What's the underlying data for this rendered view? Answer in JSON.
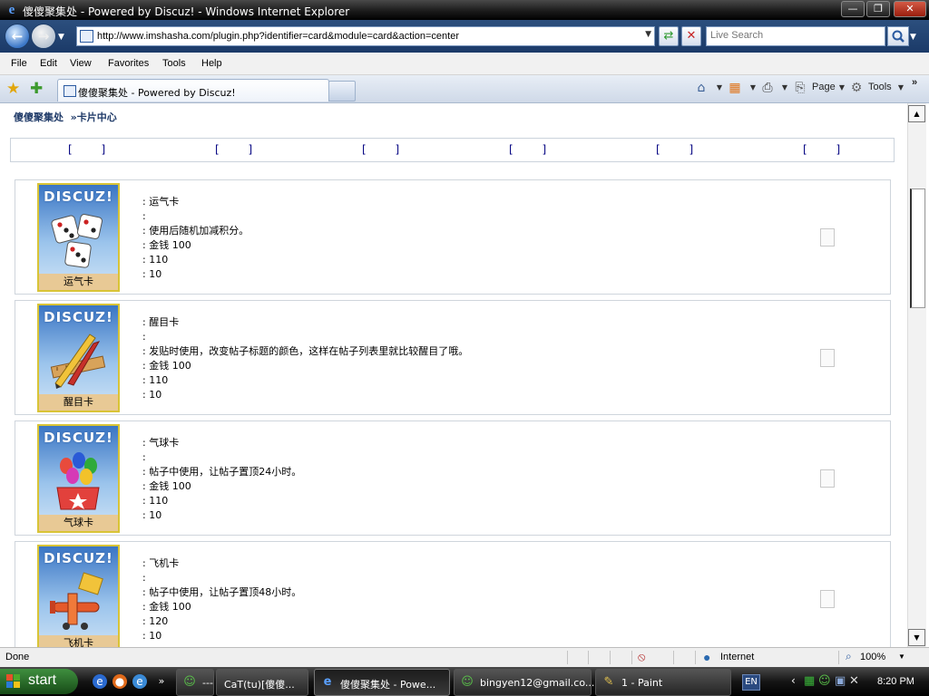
{
  "window": {
    "title": "傻傻聚集处 - Powered by Discuz! - Windows Internet Explorer",
    "controls": {
      "minimize": "—",
      "maximize": "❐",
      "close": "✕"
    }
  },
  "toolbar": {
    "url": "http://www.imshasha.com/plugin.php?identifier=card&module=card&action=center",
    "search_placeholder": "Live Search"
  },
  "menu": [
    "File",
    "Edit",
    "View",
    "Favorites",
    "Tools",
    "Help"
  ],
  "tab": {
    "label": "傻傻聚集处 - Powered by Discuz!"
  },
  "commands": {
    "page": "Page",
    "tools": "Tools"
  },
  "page": {
    "breadcrumb_site": "傻傻聚集处",
    "breadcrumb_sep": "»",
    "breadcrumb_section": "卡片中心",
    "tabs": [
      "[ ]",
      "[ ]",
      "[ ]",
      "[ ]",
      "[ ]",
      "[ ]"
    ],
    "cards": [
      {
        "name": "运气卡",
        "line2": ":",
        "desc": ":  使用后随机加减积分。",
        "price": ":  金钱  100",
        "value1": ":  110",
        "value2": ":  10",
        "icon": "dice-icon"
      },
      {
        "name": "醒目卡",
        "line2": ":",
        "desc": ":  发贴时使用，改变帖子标题的颜色，这样在帖子列表里就比较醒目了哦。",
        "price": ":  金钱  100",
        "value1": ":  110",
        "value2": ":  10",
        "icon": "pencil-ruler-icon"
      },
      {
        "name": "气球卡",
        "line2": ":",
        "desc": ":  帖子中使用，让帖子置顶24小时。",
        "price": ":  金钱  100",
        "value1": ":  110",
        "value2": ":  10",
        "icon": "balloon-gift-icon"
      },
      {
        "name": "飞机卡",
        "line2": ":",
        "desc": ":  帖子中使用，让帖子置顶48小时。",
        "price": ":  金钱  100",
        "value1": ":  120",
        "value2": ":  10",
        "icon": "plane-icon"
      }
    ],
    "card_logo": "DISCUZ!"
  },
  "status": {
    "text": "Done",
    "zone": "Internet",
    "zoom": "100%"
  },
  "taskbar": {
    "start": "start",
    "items": [
      {
        "label": "---",
        "icon": "msn-icon"
      },
      {
        "label": "CaT(tu)[傻傻...",
        "icon": "msn-icon"
      },
      {
        "label": "傻傻聚集处 - Powe...",
        "icon": "ie-icon"
      },
      {
        "label": "bingyen12@gmail.co...",
        "icon": "msn-icon"
      },
      {
        "label": "1 - Paint",
        "icon": "paint-icon"
      }
    ],
    "language": "EN",
    "clock": "8:20 PM"
  }
}
